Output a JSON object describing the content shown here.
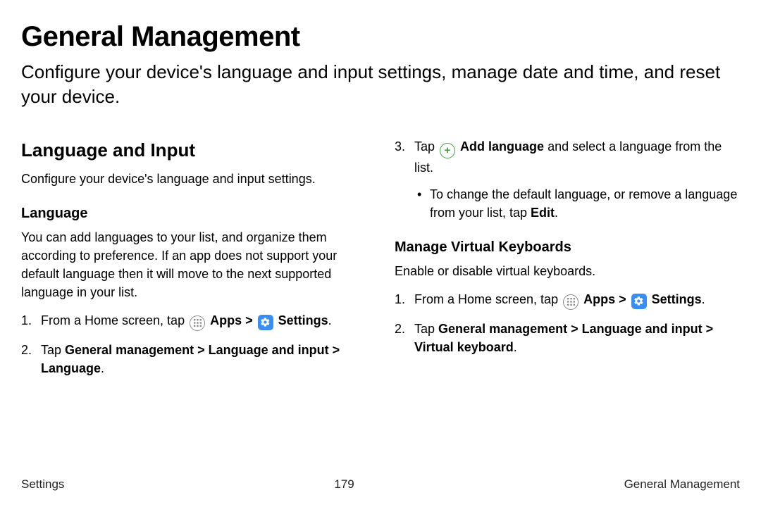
{
  "title": "General Management",
  "subtitle": "Configure your device's language and input settings, manage date and time, and reset your device.",
  "left": {
    "heading": "Language and Input",
    "intro": "Configure your device's language and input settings.",
    "sub_heading": "Language",
    "body": "You can add languages to your list, and organize them according to preference. If an app does not support your default language then it will move to the next supported language in your list.",
    "step1_pre": "From a Home screen, tap ",
    "apps_label": "Apps",
    "gt": " > ",
    "settings_label": "Settings",
    "period": ".",
    "step2_pre": "Tap ",
    "step2_path": "General management > Language and input > Language"
  },
  "right": {
    "step3_pre": "Tap ",
    "add_language_label": "Add language",
    "step3_post": " and select a language from the list.",
    "bullet_pre": "To change the default language, or remove a language from your list, tap ",
    "edit_label": "Edit",
    "sub_heading": "Manage Virtual Keyboards",
    "body": "Enable or disable virtual keyboards.",
    "step1_pre": "From a Home screen, tap ",
    "apps_label": "Apps",
    "gt": " > ",
    "settings_label": "Settings",
    "period": ".",
    "step2_pre": "Tap ",
    "step2_path": "General management > Language and input > Virtual keyboard"
  },
  "footer": {
    "left": "Settings",
    "center": "179",
    "right": "General Management"
  }
}
